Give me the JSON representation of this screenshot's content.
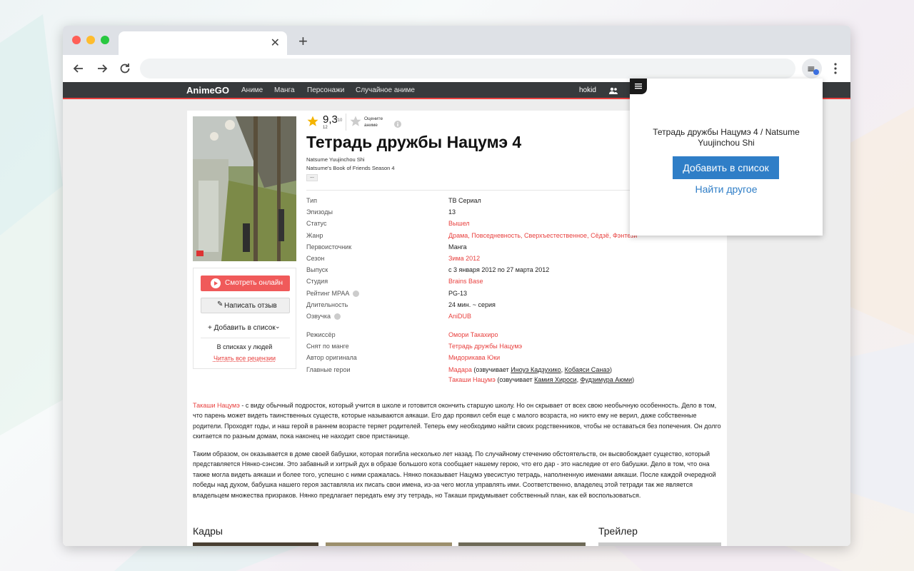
{
  "browser": {
    "traffic_colors": [
      "#ff5f57",
      "#febc2e",
      "#28c840"
    ],
    "new_tab_label": "+",
    "close_tab_label": "✕"
  },
  "site": {
    "logo": "AnimeGO",
    "nav": [
      "Аниме",
      "Манга",
      "Персонажи",
      "Случайное аниме"
    ],
    "username": "hokid",
    "accent": "#e8413f"
  },
  "anime": {
    "rating": "9,3",
    "rating_scale": "/10",
    "rating_count": "12",
    "rate_prompt": "Оцените аниме",
    "title": "Тетрадь дружбы Нацумэ 4",
    "alt_names": [
      "Natsume Yuujinchou Shi",
      "Natsume's Book of Friends Season 4"
    ],
    "more": "...",
    "buttons": {
      "watch": "Смотреть онлайн",
      "review": "Написать отзыв",
      "add": "+ Добавить в список",
      "in_lists": "В списках у людей",
      "read_reviews": "Читать все рецензии"
    },
    "info": [
      {
        "label": "Тип",
        "value": "ТВ Сериал"
      },
      {
        "label": "Эпизоды",
        "value": "13"
      },
      {
        "label": "Статус",
        "value": "Вышел"
      },
      {
        "label": "Жанр",
        "value": "Драма, Повседневность, Сверхъестественное, Сёдзё, Фэнтези"
      },
      {
        "label": "Первоисточник",
        "value": "Манга"
      },
      {
        "label": "Сезон",
        "value": "Зима 2012"
      },
      {
        "label": "Выпуск",
        "value": "с 3 января 2012 по 27 марта 2012"
      },
      {
        "label": "Студия",
        "value": "Brains Base"
      },
      {
        "label": "Рейтинг MPAA",
        "value": "PG-13"
      },
      {
        "label": "Длительность",
        "value": "24 мин. ~ серия"
      },
      {
        "label": "Озвучка",
        "value": "AniDUB"
      }
    ],
    "crew": [
      {
        "label": "Режиссёр",
        "value": "Омори Такахиро"
      },
      {
        "label": "Снят по манге",
        "value": "Тетрадь дружбы Нацумэ"
      },
      {
        "label": "Автор оригинала",
        "value": "Мидорикава Юки"
      },
      {
        "label": "Главные герои"
      }
    ],
    "heroes": [
      {
        "name": "Мадара",
        "pre": " (озвучивает ",
        "va1": "Иноуэ Кадзухико",
        "sep": ", ",
        "va2": "Кобаяси Санаэ",
        "post": ")"
      },
      {
        "name": "Такаши Нацумэ",
        "pre": " (озвучивает ",
        "va1": "Камия Хироси",
        "sep": ", ",
        "va2": "Фудзимура Аюми",
        "post": ")"
      }
    ],
    "desc1_link": "Такаши Нацумэ",
    "desc1": " - с виду обычный подросток, который учится в школе и готовится окончить старшую школу. Но он скрывает от всех свою необычную особенность. Дело в том, что парень может видеть таинственных существ, которые называются аякаши. Его дар проявил себя еще с малого возраста, но никто ему не верил, даже собственные родители. Проходят годы, и наш герой в раннем возрасте теряет родителей. Теперь ему необходимо найти своих родственников, чтобы не оставаться без попечения. Он долго скитается по разным домам, пока наконец не находит свое пристанище.",
    "desc2": "Таким образом, он оказывается в доме своей бабушки, которая погибла несколько лет назад. По случайному стечению обстоятельств, он высвобождает существо, который представляется Нянко-сэнсэм. Это забавный и хитрый дух в образе большого кота сообщает нашему герою, что его дар - это наследие от его бабушки. Дело в том, что она также могла видеть аякаши и более того, успешно с ними сражалась. Нянко показывает Нацумэ увесистую тетрадь, наполненную именами аякаши. После каждой очередной победы над духом, бабушка нашего героя заставляла их писать свои имена, из-за чего могла управлять ими. Соответственно, владелец этой тетради так же является владельцем множества призраков. Нянко предлагает передать ему эту тетрадь, но Такаши придумывает собственный план, как ей воспользоваться.",
    "frames_heading": "Кадры",
    "trailer_heading": "Трейлер"
  },
  "popup": {
    "title": "Тетрадь дружбы Нацумэ 4 / Natsume Yuujinchou Shi",
    "add_button": "Добавить в список",
    "find_other": "Найти другое",
    "accent": "#2f7ec7"
  }
}
